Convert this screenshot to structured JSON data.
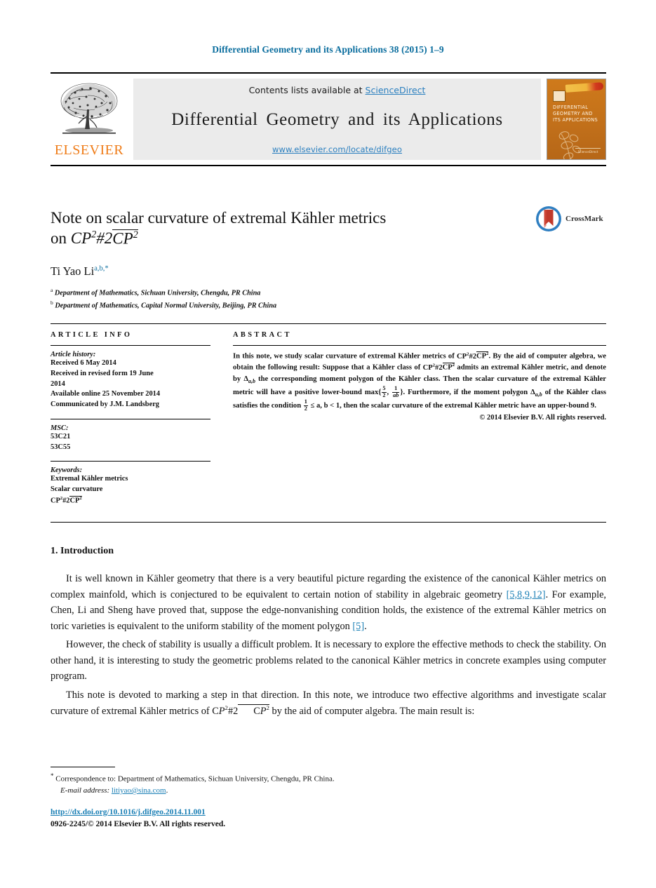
{
  "running_head": "Differential Geometry and its Applications 38 (2015) 1–9",
  "masthead": {
    "publisher_name": "ELSEVIER",
    "contents_prefix": "Contents lists available at ",
    "sciencedirect_link": "ScienceDirect",
    "journal_name": "Differential Geometry and its Applications",
    "journal_url": "www.elsevier.com/locate/difgeo",
    "cover_title": "DIFFERENTIAL GEOMETRY AND ITS APPLICATIONS",
    "cover_footer": "ScienceDirect"
  },
  "article": {
    "title_line1": "Note on scalar curvature of extremal Kähler metrics",
    "title_line2_prefix": "on ",
    "title_math_cp": "CP",
    "title_math_sup": "2",
    "title_math_hash": "#2",
    "author": "Ti Yao Li",
    "author_marks": "a,b,*",
    "affiliations": [
      {
        "mark": "a",
        "text": "Department of Mathematics, Sichuan University, Chengdu, PR China"
      },
      {
        "mark": "b",
        "text": "Department of Mathematics, Capital Normal University, Beijing, PR China"
      }
    ],
    "crossmark_label": "CrossMark"
  },
  "info": {
    "heading": "ARTICLE INFO",
    "history_label": "Article history:",
    "history_lines": [
      "Received 6 May 2014",
      "Received in revised form 19 June",
      "2014",
      "Available online 25 November 2014",
      "Communicated by J.M. Landsberg"
    ],
    "msc_label": "MSC:",
    "msc_codes": [
      "53C21",
      "53C55"
    ],
    "keywords_label": "Keywords:",
    "keywords": [
      "Extremal Kähler metrics",
      "Scalar curvature",
      "CP2#2CP2"
    ]
  },
  "abstract": {
    "heading": "ABSTRACT",
    "part1": "In this note, we study scalar curvature of extremal Kähler metrics of ",
    "part2": ". By the aid of computer algebra, we obtain the following result: Suppose that a Kähler class of ",
    "part3": " admits an extremal Kähler metric, and denote by ",
    "delta_ab": "Δ",
    "delta_sub": "a,b",
    "part4": " the corresponding moment polygon of the Kähler class. Then the scalar curvature of the extremal Kähler metric will have a positive lower-bound max{",
    "frac1_num": "5",
    "frac1_den": "2",
    "frac2_num": "1",
    "frac2_den": "ab",
    "part5": "}. Furthermore, if the moment polygon ",
    "part6": " of the Kähler class satisfies the condition ",
    "frac3_num": "1",
    "frac3_den": "2",
    "part7": " ≤ a, b < 1, then the scalar curvature of the extremal Kähler metric have an upper-bound 9.",
    "copyright": "© 2014 Elsevier B.V. All rights reserved."
  },
  "body": {
    "section_number_title": "1. Introduction",
    "para1_a": "It is well known in Kähler geometry that there is a very beautiful picture regarding the existence of the canonical Kähler metrics on complex mainfold, which is conjectured to be equivalent to certain notion of stability in algebraic geometry ",
    "para1_cite1": "[5,8,9,12]",
    "para1_b": ". For example, Chen, Li and Sheng have proved that, suppose the edge-nonvanishing condition holds, the existence of the extremal Kähler metrics on toric varieties is equivalent to the  uniform stability of the moment polygon ",
    "para1_cite2": "[5]",
    "para1_c": ".",
    "para2": "However, the check of stability is usually a difficult problem. It is necessary to explore the effective methods to check the stability. On other hand, it is interesting to study the geometric problems related to the canonical Kähler metrics in concrete examples using computer program.",
    "para3_a": "This note is devoted to marking a step in that direction. In this note, we introduce two effective algorithms and investigate scalar curvature of extremal Kähler metrics of ",
    "para3_b": " by the aid of computer algebra. The main result is:"
  },
  "footnotes": {
    "correspondence": "Correspondence to: Department of Mathematics, Sichuan University, Chengdu, PR China.",
    "email_label": "E-mail address:",
    "email": "litiyao@sina.com",
    "email_period": ".",
    "doi": "http://dx.doi.org/10.1016/j.difgeo.2014.11.001",
    "issn_line": "0926-2245/© 2014 Elsevier B.V. All rights reserved."
  },
  "colors": {
    "link_blue": "#1a7fb5",
    "running_head_blue": "#0a6d9e",
    "elsevier_orange": "#ef7c18",
    "banner_gray": "#ebebeb"
  }
}
